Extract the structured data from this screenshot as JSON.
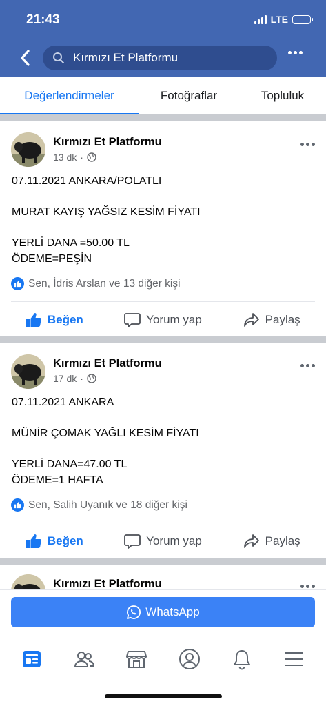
{
  "status_bar": {
    "time": "21:43",
    "network": "LTE"
  },
  "header": {
    "search_text": "Kırmızı Et Platformu"
  },
  "tabs": [
    {
      "label": "Değerlendirmeler",
      "active": true
    },
    {
      "label": "Fotoğraflar",
      "active": false
    },
    {
      "label": "Topluluk",
      "active": false
    }
  ],
  "posts": [
    {
      "author": "Kırmızı Et Platformu",
      "time": "13 dk",
      "lines": [
        "07.11.2021 ANKARA/POLATLI",
        "",
        "MURAT KAYIŞ YAĞSIZ KESİM FİYATI",
        "",
        "YERLİ DANA =50.00 TL",
        "ÖDEME=PEŞİN"
      ],
      "reactions": "Sen, İdris Arslan ve 13 diğer kişi"
    },
    {
      "author": "Kırmızı Et Platformu",
      "time": "17 dk",
      "lines": [
        "07.11.2021 ANKARA",
        "",
        "MÜNİR ÇOMAK YAĞLI KESİM FİYATI",
        "",
        "YERLİ DANA=47.00 TL",
        "ÖDEME=1 HAFTA"
      ],
      "reactions": "Sen, Salih Uyanık ve 18 diğer kişi"
    },
    {
      "author": "Kırmızı Et Platformu"
    }
  ],
  "actions": {
    "like": "Beğen",
    "comment": "Yorum yap",
    "share": "Paylaş"
  },
  "whatsapp_button": "WhatsApp",
  "colors": {
    "brand_blue": "#4267b2",
    "accent": "#1877f2",
    "whatsapp_btn": "#3b82f6"
  },
  "bottom_nav": [
    "feed-icon",
    "friends-icon",
    "marketplace-icon",
    "profile-icon",
    "bell-icon",
    "menu-icon"
  ]
}
